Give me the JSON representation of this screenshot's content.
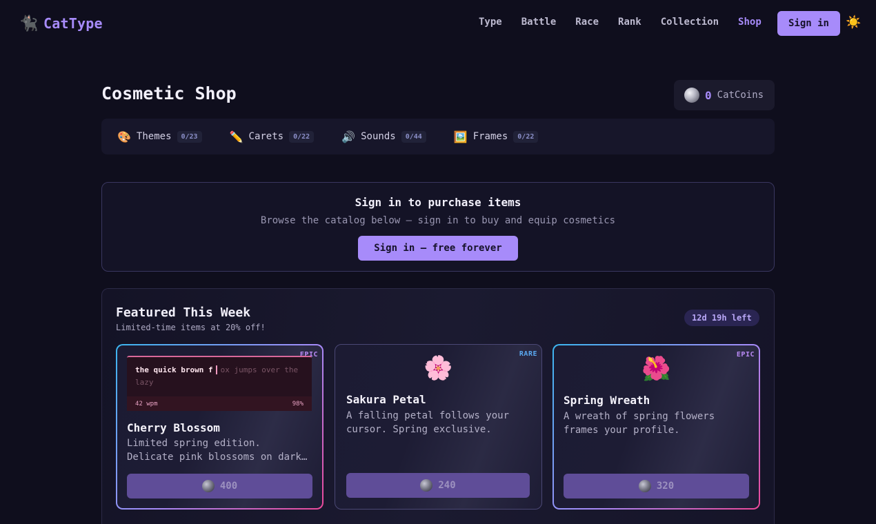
{
  "brand": {
    "name": "CatType",
    "icon": "cat-logo-icon"
  },
  "nav": {
    "items": [
      {
        "label": "Type"
      },
      {
        "label": "Battle"
      },
      {
        "label": "Race"
      },
      {
        "label": "Rank"
      },
      {
        "label": "Collection"
      },
      {
        "label": "Shop",
        "active": true
      }
    ],
    "signin_label": "Sign in",
    "theme_icon": "sun-icon"
  },
  "page": {
    "title": "Cosmetic Shop"
  },
  "wallet": {
    "amount": "0",
    "label": "CatCoins",
    "icon": "coin-icon"
  },
  "tabs": [
    {
      "emoji": "🎨",
      "label": "Themes",
      "count": "0/23"
    },
    {
      "emoji": "✏️",
      "label": "Carets",
      "count": "0/22"
    },
    {
      "emoji": "🔊",
      "label": "Sounds",
      "count": "0/44"
    },
    {
      "emoji": "🖼️",
      "label": "Frames",
      "count": "0/22"
    }
  ],
  "signin_card": {
    "heading": "Sign in to purchase items",
    "subtext": "Browse the catalog below — sign in to buy and equip cosmetics",
    "cta": "Sign in — free forever"
  },
  "featured": {
    "title": "Featured This Week",
    "subtitle": "Limited-time items at 20% off!",
    "timer": "12d 19h left",
    "items": [
      {
        "rarity": "EPIC",
        "name": "Cherry Blossom",
        "desc_line1": "Limited spring edition.",
        "desc_line2": "Delicate pink blossoms on dark…",
        "price": "400",
        "preview": {
          "typed": "the quick brown f",
          "untyped": "ox jumps over the lazy",
          "wpm": "42 wpm",
          "accuracy": "98%"
        }
      },
      {
        "rarity": "RARE",
        "emoji": "🌸",
        "name": "Sakura Petal",
        "desc": "A falling petal follows your cursor. Spring exclusive.",
        "price": "240"
      },
      {
        "rarity": "EPIC",
        "emoji": "🌺",
        "name": "Spring Wreath",
        "desc": "A wreath of spring flowers frames your profile.",
        "price": "320"
      }
    ]
  },
  "colors": {
    "accent": "#a78bfa",
    "background": "#0f0e1d",
    "epic": "#b98af5",
    "rare": "#5aa8f0"
  }
}
